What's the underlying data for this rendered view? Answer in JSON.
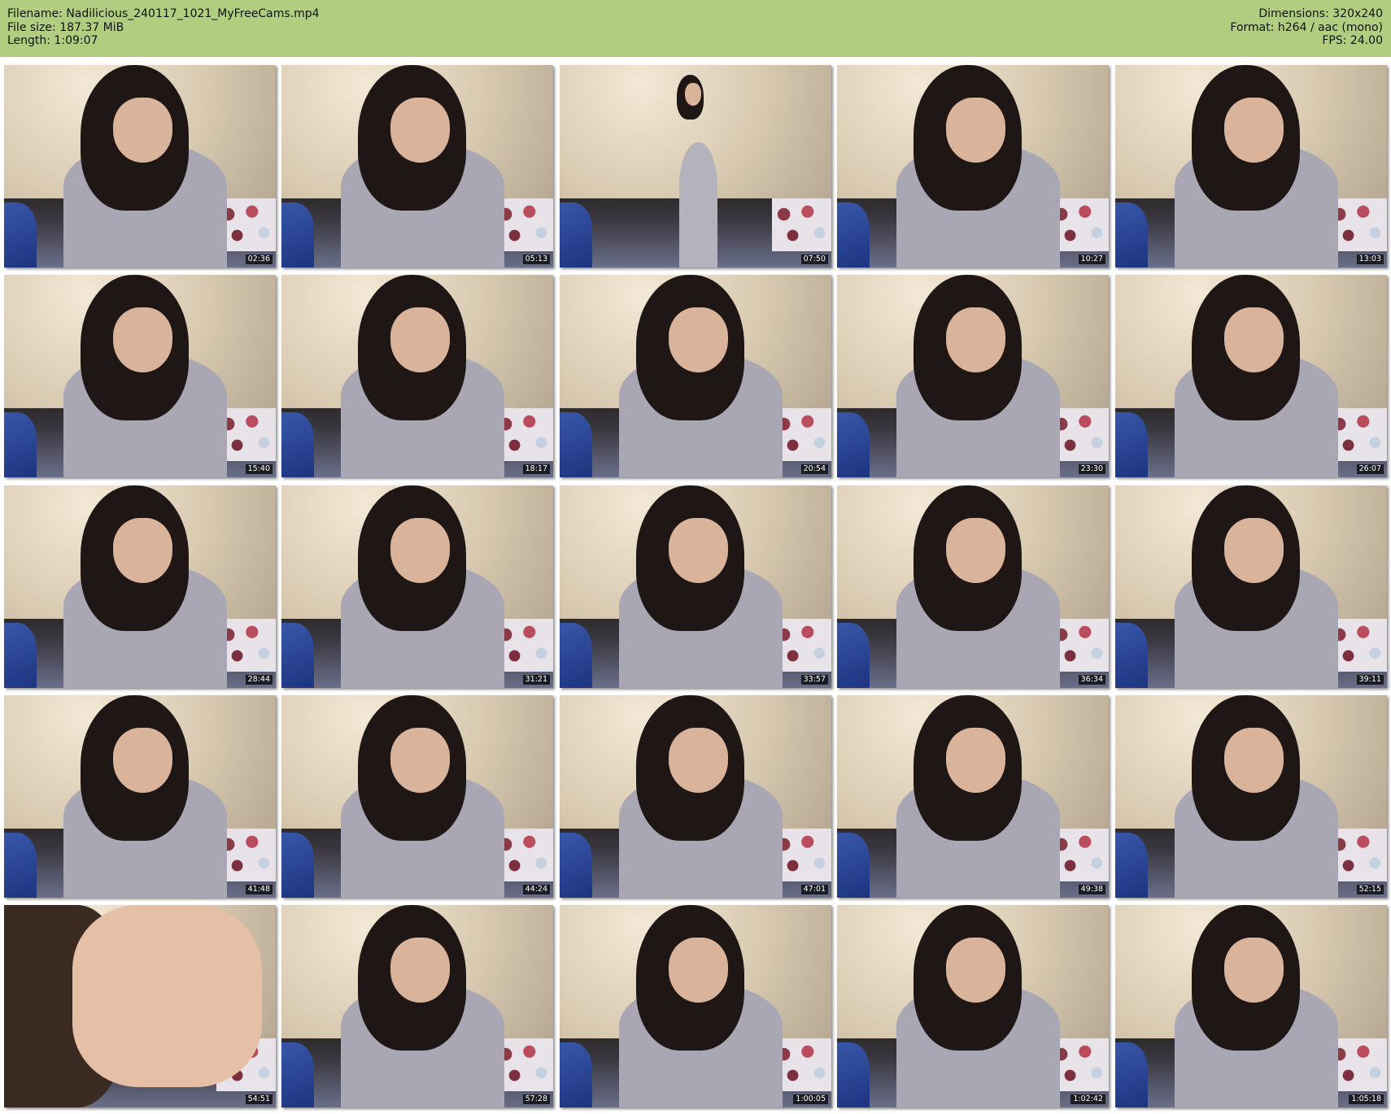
{
  "header": {
    "background_color": "#b1cd80",
    "left": [
      {
        "label": "Filename:",
        "value": "Nadilicious_240117_1021_MyFreeCams.mp4"
      },
      {
        "label": "File size:",
        "value": "187.37 MiB"
      },
      {
        "label": "Length:",
        "value": "1:09:07"
      }
    ],
    "right": [
      {
        "label": "Dimensions:",
        "value": "320x240"
      },
      {
        "label": "Format:",
        "value": "h264 / aac (mono)"
      },
      {
        "label": "FPS:",
        "value": "24.00"
      }
    ]
  },
  "thumbnails": [
    {
      "timestamp": "02:36",
      "pose": "normal"
    },
    {
      "timestamp": "05:13",
      "pose": "normal"
    },
    {
      "timestamp": "07:50",
      "pose": "far"
    },
    {
      "timestamp": "10:27",
      "pose": "normal"
    },
    {
      "timestamp": "13:03",
      "pose": "normal"
    },
    {
      "timestamp": "15:40",
      "pose": "normal"
    },
    {
      "timestamp": "18:17",
      "pose": "normal"
    },
    {
      "timestamp": "20:54",
      "pose": "normal"
    },
    {
      "timestamp": "23:30",
      "pose": "normal"
    },
    {
      "timestamp": "26:07",
      "pose": "normal"
    },
    {
      "timestamp": "28:44",
      "pose": "normal"
    },
    {
      "timestamp": "31:21",
      "pose": "normal"
    },
    {
      "timestamp": "33:57",
      "pose": "normal"
    },
    {
      "timestamp": "36:34",
      "pose": "normal"
    },
    {
      "timestamp": "39:11",
      "pose": "normal"
    },
    {
      "timestamp": "41:48",
      "pose": "normal"
    },
    {
      "timestamp": "44:24",
      "pose": "normal"
    },
    {
      "timestamp": "47:01",
      "pose": "normal"
    },
    {
      "timestamp": "49:38",
      "pose": "normal"
    },
    {
      "timestamp": "52:15",
      "pose": "normal"
    },
    {
      "timestamp": "54:51",
      "pose": "close"
    },
    {
      "timestamp": "57:28",
      "pose": "normal"
    },
    {
      "timestamp": "1:00:05",
      "pose": "normal"
    },
    {
      "timestamp": "1:02:42",
      "pose": "normal"
    },
    {
      "timestamp": "1:05:18",
      "pose": "normal"
    }
  ]
}
